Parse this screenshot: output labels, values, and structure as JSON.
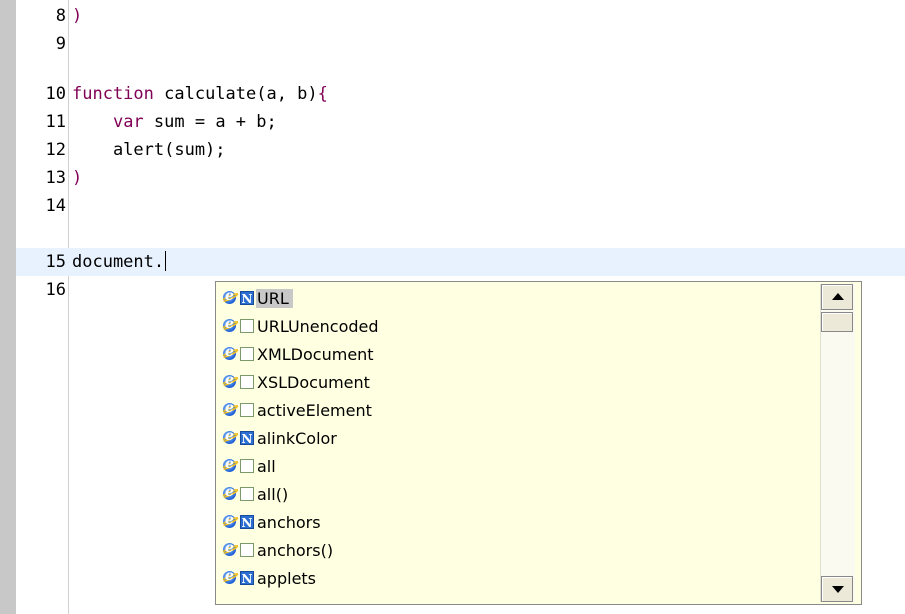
{
  "editor": {
    "lines": [
      {
        "number": "8",
        "tokens": [
          {
            "text": ")",
            "kind": "br"
          }
        ]
      },
      {
        "number": "9",
        "tokens": []
      },
      {
        "number": "10",
        "tokens": [
          {
            "text": "function",
            "kind": "kw"
          },
          {
            "text": " calculate(a, b)",
            "kind": "plain"
          },
          {
            "text": "{",
            "kind": "br"
          }
        ]
      },
      {
        "number": "11",
        "tokens": [
          {
            "text": "    ",
            "kind": "plain"
          },
          {
            "text": "var",
            "kind": "kw"
          },
          {
            "text": " sum = a + b;",
            "kind": "plain"
          }
        ]
      },
      {
        "number": "12",
        "tokens": [
          {
            "text": "    alert(sum);",
            "kind": "plain"
          }
        ]
      },
      {
        "number": "13",
        "tokens": [
          {
            "text": ")",
            "kind": "br"
          }
        ]
      },
      {
        "number": "14",
        "tokens": []
      },
      {
        "number": "15",
        "tokens": [
          {
            "text": "document.",
            "kind": "plain"
          }
        ],
        "current": true
      },
      {
        "number": "16",
        "tokens": []
      }
    ]
  },
  "autocomplete": {
    "items": [
      {
        "label": "URL",
        "type": "N",
        "selected": true
      },
      {
        "label": "URLUnencoded",
        "type": "box"
      },
      {
        "label": "XMLDocument",
        "type": "box"
      },
      {
        "label": "XSLDocument",
        "type": "box"
      },
      {
        "label": "activeElement",
        "type": "box"
      },
      {
        "label": "alinkColor",
        "type": "N"
      },
      {
        "label": "all",
        "type": "box"
      },
      {
        "label": "all()",
        "type": "box"
      },
      {
        "label": "anchors",
        "type": "N"
      },
      {
        "label": "anchors()",
        "type": "box"
      },
      {
        "label": "applets",
        "type": "N"
      }
    ],
    "icon": "internet-explorer-icon",
    "type_icon_N": "N"
  },
  "colors": {
    "keyword": "#7f0055",
    "popup_bg": "#ffffe1",
    "current_line": "#e8f2fe",
    "gutter": "#c8c8c8"
  }
}
